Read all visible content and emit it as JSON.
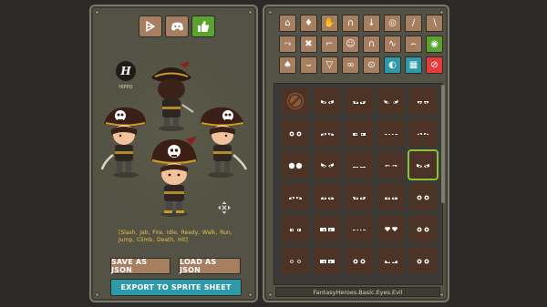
{
  "social": {
    "codepen_icon": "codepen-icon",
    "discord_icon": "discord-icon",
    "like_icon": "thumbs-up-icon"
  },
  "brand": {
    "logo_letter": "H",
    "label": "HIPPO"
  },
  "animations": "[Slash, Jab, Fire, Idle, Ready, Walk, Run, Jump, Climb, Death, Hit]",
  "buttons": {
    "save_json": "SAVE AS JSON",
    "load_json": "LOAD AS JSON",
    "export": "EXPORT TO SPRITE SHEET"
  },
  "toolbar": {
    "rows": [
      [
        "helmet-icon",
        "armor-icon",
        "gloves-icon",
        "pants-icon",
        "boots-icon",
        "shield-icon",
        "sword-icon",
        "dagger-icon"
      ],
      [
        "bow-icon",
        "crossbow-icon",
        "firearm-icon",
        "body-icon",
        "hair-icon",
        "mustache-icon",
        "eyebrows-icon",
        "eyes-icon"
      ],
      [
        "ears-icon",
        "mouth-icon",
        "cape-icon",
        "mask-icon",
        "earrings-icon",
        "palette-icon",
        "layout-icon",
        "reset-icon"
      ]
    ],
    "active": "eyes-icon"
  },
  "grid": {
    "selected_index": 14,
    "columns": 5,
    "rows": 6
  },
  "status": "FantasyHeroes.Basic.Eyes.Evil",
  "colors": {
    "panel": "#545244",
    "button_brown": "#a67f60",
    "button_green": "#5aa331",
    "button_teal": "#2c9aa8",
    "button_red": "#e53b3b",
    "anim_text": "#e3c447",
    "cell_bg": "#4d3325",
    "selection": "#8ac23a"
  }
}
